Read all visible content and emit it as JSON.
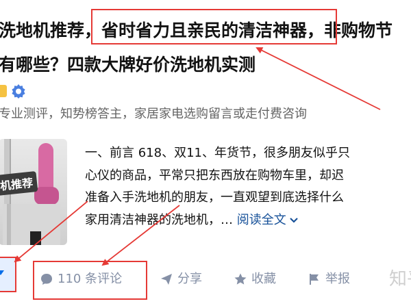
{
  "article": {
    "title_line1": "洗地机推荐，省时省力且亲民的清洁神器，非购物节",
    "title_line2": "有哪些？四款大牌好价洗地机实测",
    "author_info": "专业测评，知势榜答主，家居家电选购留言或走付费咨询",
    "thumbnail_caption": "机推荐",
    "excerpt_lines": [
      "一、前言 618、双11、年货节，很多朋友似乎只",
      "心仪的商品，平常只把东西放在购物车里，却迟",
      "准备入手洗地机的朋友，一直观望到底选择什么",
      "家用清洁神器的洗地机，… "
    ],
    "read_more": "阅读全文"
  },
  "actions": {
    "comment": "110 条评论",
    "share": "分享",
    "favorite": "收藏",
    "report": "举报"
  },
  "watermark": "知乎",
  "annotation_color": "#e53935",
  "link_color": "#175199",
  "action_color": "#8590a6"
}
